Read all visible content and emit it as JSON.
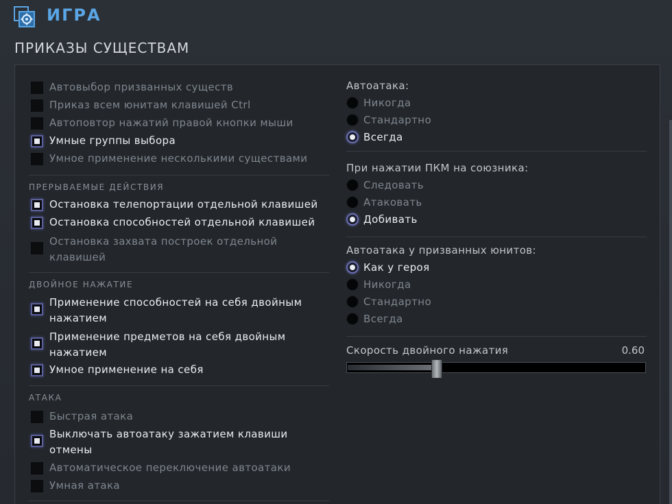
{
  "header": {
    "title": "ИГРА",
    "icon": "gear-icon",
    "accent": "#5aa6e6"
  },
  "section": {
    "title": "ПРИКАЗЫ СУЩЕСТВАМ"
  },
  "left": {
    "general": [
      {
        "label": "Автовыбор призванных существ",
        "checked": false
      },
      {
        "label": "Приказ всем юнитам клавишей Ctrl",
        "checked": false
      },
      {
        "label": "Автоповтор нажатий правой кнопки мыши",
        "checked": false
      },
      {
        "label": "Умные группы выбора",
        "checked": true
      },
      {
        "label": "Умное применение несколькими существами",
        "checked": false
      }
    ],
    "interrupt": {
      "title": "ПРЕРЫВАЕМЫЕ ДЕЙСТВИЯ",
      "items": [
        {
          "label": "Остановка телепортации отдельной клавишей",
          "checked": true
        },
        {
          "label": "Остановка способностей отдельной клавишей",
          "checked": true
        },
        {
          "label": "Остановка захвата построек отдельной клавишей",
          "checked": false
        }
      ]
    },
    "double": {
      "title": "ДВОЙНОЕ НАЖАТИЕ",
      "items": [
        {
          "label": "Применение способностей на себя двойным нажатием",
          "checked": true
        },
        {
          "label": "Применение предметов на себя двойным нажатием",
          "checked": true
        },
        {
          "label": "Умное применение на себя",
          "checked": true
        }
      ]
    },
    "attack": {
      "title": "АТАКА",
      "items": [
        {
          "label": "Быстрая атака",
          "checked": false
        },
        {
          "label": "Выключать автоатаку зажатием клавиши отмены",
          "checked": true
        },
        {
          "label": "Автоматическое переключение автоатаки",
          "checked": false
        },
        {
          "label": "Умная атака",
          "checked": false
        }
      ]
    }
  },
  "right": {
    "autoattack": {
      "title": "Автоатака:",
      "options": [
        "Никогда",
        "Стандартно",
        "Всегда"
      ],
      "selected": 2
    },
    "rmb_ally": {
      "title": "При нажатии ПКМ на союзника:",
      "options": [
        "Следовать",
        "Атаковать",
        "Добивать"
      ],
      "selected": 2
    },
    "summons": {
      "title": "Автоатака у призванных юнитов:",
      "options": [
        "Как у героя",
        "Никогда",
        "Стандартно",
        "Всегда"
      ],
      "selected": 0
    },
    "slider": {
      "label": "Скорость двойного нажатия",
      "value_text": "0.60",
      "value": 0.3
    }
  }
}
